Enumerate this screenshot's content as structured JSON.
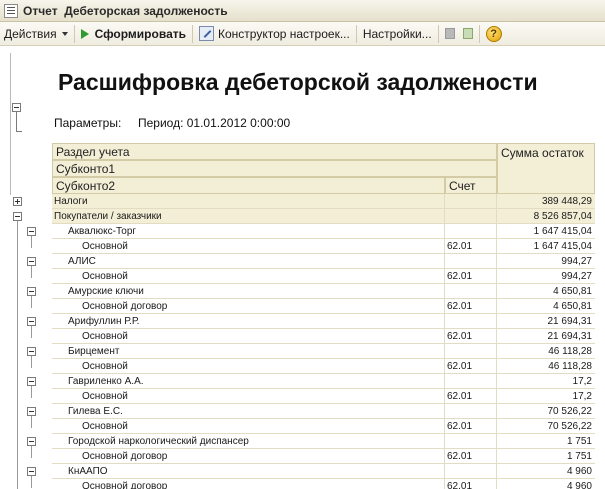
{
  "window": {
    "title": "Отчет  Дебеторская задолженость"
  },
  "toolbar": {
    "actions_label": "Действия",
    "generate_label": "Сформировать",
    "constructor_label": "Конструктор настроек...",
    "settings_label": "Настройки...",
    "help_label": "?"
  },
  "report": {
    "title": "Расшифровка дебеторской задолжености",
    "params_label": "Параметры:",
    "period_text": "Период: 01.01.2012 0:00:00",
    "headers": {
      "section": "Раздел учета",
      "subkonto1": "Субконто1",
      "subkonto2": "Субконто2",
      "account": "Счет",
      "sum": "Сумма остаток"
    },
    "rows": [
      {
        "name": "Налоги",
        "account": "",
        "sum": "389 448,29",
        "level": 0
      },
      {
        "name": "Покупатели / заказчики",
        "account": "",
        "sum": "8 526 857,04",
        "level": 0
      },
      {
        "name": "Аквалюкс-Торг",
        "account": "",
        "sum": "1 647 415,04",
        "level": 1
      },
      {
        "name": "Основной",
        "account": "62.01",
        "sum": "1 647 415,04",
        "level": 2
      },
      {
        "name": "АЛИС",
        "account": "",
        "sum": "994,27",
        "level": 1
      },
      {
        "name": "Основной",
        "account": "62.01",
        "sum": "994,27",
        "level": 2
      },
      {
        "name": "Амурские ключи",
        "account": "",
        "sum": "4 650,81",
        "level": 1
      },
      {
        "name": "Основной договор",
        "account": "62.01",
        "sum": "4 650,81",
        "level": 2
      },
      {
        "name": "Арифуллин Р.Р.",
        "account": "",
        "sum": "21 694,31",
        "level": 1
      },
      {
        "name": "Основной",
        "account": "62.01",
        "sum": "21 694,31",
        "level": 2
      },
      {
        "name": "Бирцемент",
        "account": "",
        "sum": "46 118,28",
        "level": 1
      },
      {
        "name": "Основной",
        "account": "62.01",
        "sum": "46 118,28",
        "level": 2
      },
      {
        "name": "Гавриленко А.А.",
        "account": "",
        "sum": "17,2",
        "level": 1
      },
      {
        "name": "Основной",
        "account": "62.01",
        "sum": "17,2",
        "level": 2
      },
      {
        "name": "Гилева Е.С.",
        "account": "",
        "sum": "70 526,22",
        "level": 1
      },
      {
        "name": "Основной",
        "account": "62.01",
        "sum": "70 526,22",
        "level": 2
      },
      {
        "name": "Городской наркологический диспансер",
        "account": "",
        "sum": "1 751",
        "level": 1
      },
      {
        "name": "Основной договор",
        "account": "62.01",
        "sum": "1 751",
        "level": 2
      },
      {
        "name": "КнААПО",
        "account": "",
        "sum": "4 960",
        "level": 1
      },
      {
        "name": "Основной договор",
        "account": "62.01",
        "sum": "4 960",
        "level": 2
      }
    ]
  }
}
